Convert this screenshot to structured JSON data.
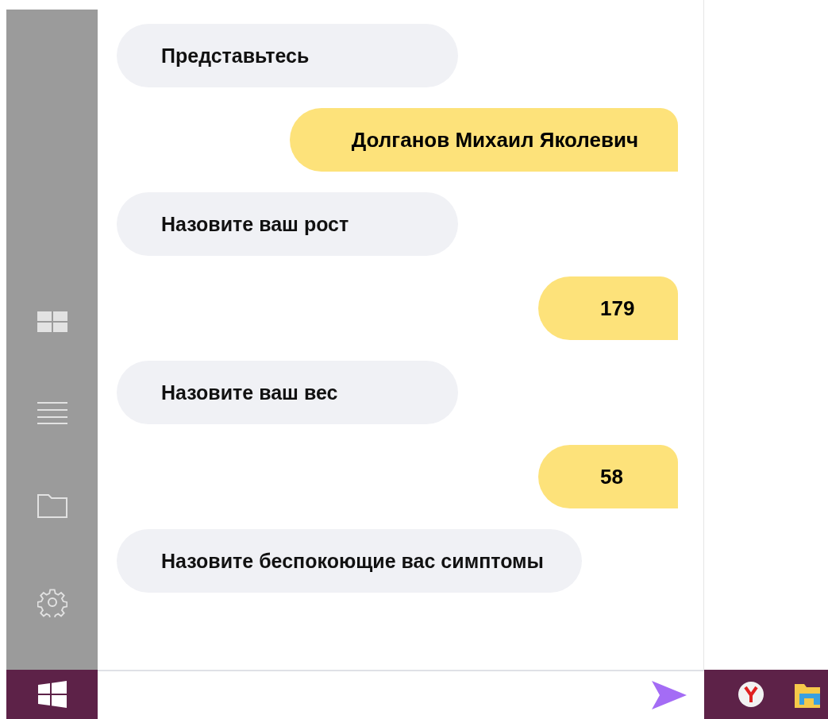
{
  "messages": [
    {
      "kind": "bot",
      "text": "Представьтесь"
    },
    {
      "kind": "user",
      "text": "Долганов Михаил Яколевич"
    },
    {
      "kind": "bot",
      "text": "Назовите ваш рост"
    },
    {
      "kind": "user",
      "text": "179"
    },
    {
      "kind": "bot",
      "text": "Назовите ваш вес"
    },
    {
      "kind": "user",
      "text": "58"
    },
    {
      "kind": "bot",
      "text": "Назовите беспокоющие вас симптомы"
    }
  ]
}
